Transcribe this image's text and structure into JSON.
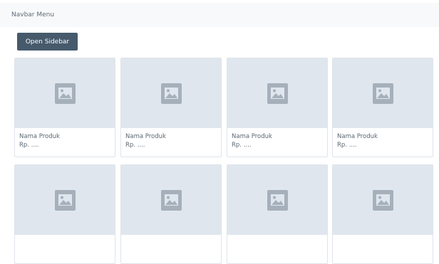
{
  "navbar": {
    "title": "Navbar Menu"
  },
  "toolbar": {
    "open_sidebar_label": "Open Sidebar"
  },
  "colors": {
    "button_bg": "#465a6c",
    "navbar_bg": "#f8f9fa",
    "image_placeholder_bg": "#dfe6ee",
    "image_icon": "#a6b0bb"
  },
  "products": [
    {
      "name": "Nama Produk",
      "price": "Rp. ....",
      "image_icon": "image-icon"
    },
    {
      "name": "Nama Produk",
      "price": "Rp. ....",
      "image_icon": "image-icon"
    },
    {
      "name": "Nama Produk",
      "price": "Rp. ....",
      "image_icon": "image-icon"
    },
    {
      "name": "Nama Produk",
      "price": "Rp. ....",
      "image_icon": "image-icon"
    },
    {
      "name": "",
      "price": "",
      "image_icon": "image-icon"
    },
    {
      "name": "",
      "price": "",
      "image_icon": "image-icon"
    },
    {
      "name": "",
      "price": "",
      "image_icon": "image-icon"
    },
    {
      "name": "",
      "price": "",
      "image_icon": "image-icon"
    }
  ]
}
